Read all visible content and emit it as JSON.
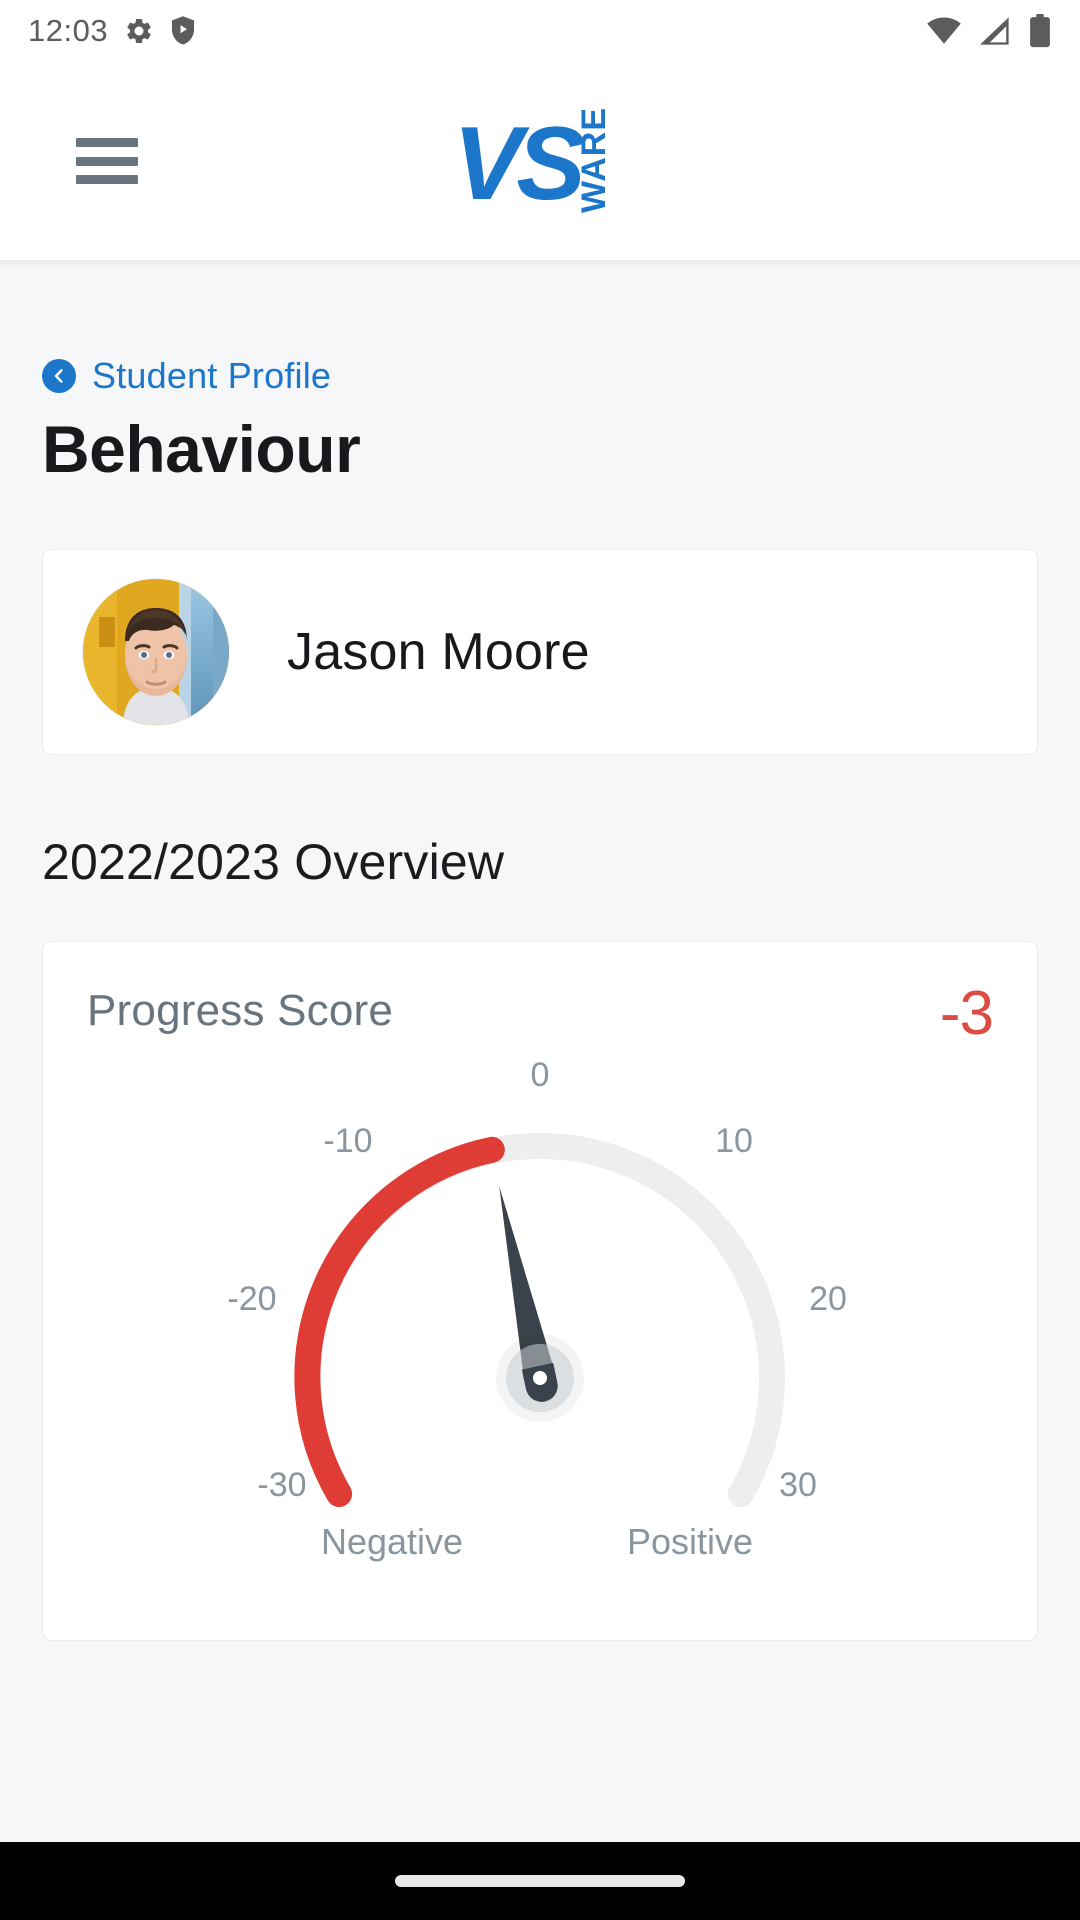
{
  "status_bar": {
    "time": "12:03",
    "left_icons": [
      "gear-icon",
      "shield-play-icon"
    ],
    "right_icons": [
      "wifi-icon",
      "cellular-signal-icon",
      "battery-icon"
    ]
  },
  "header": {
    "menu_icon": "hamburger-menu-icon",
    "logo_text": "VS",
    "logo_sub_text": "WARE",
    "logo_color": "#1C76C9"
  },
  "breadcrumb": {
    "back_icon": "chevron-left-circle-icon",
    "label": "Student Profile"
  },
  "page": {
    "title": "Behaviour",
    "section_title": "2022/2023 Overview"
  },
  "student": {
    "name": "Jason Moore",
    "avatar": "student-photo"
  },
  "progress_card": {
    "label": "Progress Score",
    "value": "-3",
    "value_color": "#DD4B43"
  },
  "chart_data": {
    "type": "gauge",
    "title": "Progress Score",
    "value": -3,
    "min": -30,
    "max": 30,
    "tick_labels": [
      "-30",
      "-20",
      "-10",
      "0",
      "10",
      "20",
      "30"
    ],
    "tick_values": [
      -30,
      -20,
      -10,
      0,
      10,
      20,
      30
    ],
    "end_labels": {
      "left": "Negative",
      "right": "Positive"
    },
    "arc_colors": {
      "negative": "#E03C36",
      "neutral": "#EDEEEF"
    },
    "needle_color": "#3A434B",
    "start_angle_deg": -120,
    "end_angle_deg": 120,
    "grid": false,
    "legend": "none"
  },
  "nav_bar": {
    "handle": "gesture-pill"
  }
}
